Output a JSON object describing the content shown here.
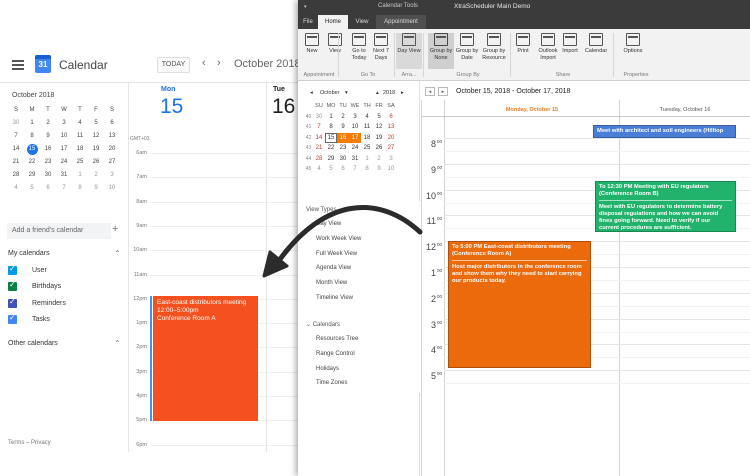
{
  "gcal": {
    "app_title": "Calendar",
    "logo_day": "31",
    "today_label": "TODAY",
    "prev_icon": "‹",
    "next_icon": "›",
    "current_month": "October 2018",
    "mini_title": "October 2018",
    "mini_weekdays": [
      "S",
      "M",
      "T",
      "W",
      "T",
      "F",
      "S"
    ],
    "mini_weeks": [
      [
        "30",
        "1",
        "2",
        "3",
        "4",
        "5",
        "6"
      ],
      [
        "7",
        "8",
        "9",
        "10",
        "11",
        "12",
        "13"
      ],
      [
        "14",
        "15",
        "16",
        "17",
        "18",
        "19",
        "20"
      ],
      [
        "21",
        "22",
        "23",
        "24",
        "25",
        "26",
        "27"
      ],
      [
        "28",
        "29",
        "30",
        "31",
        "1",
        "2",
        "3"
      ],
      [
        "4",
        "5",
        "6",
        "7",
        "8",
        "9",
        "10"
      ]
    ],
    "friend_placeholder": "Add a friend's calendar",
    "my_calendars": "My calendars",
    "calendars": [
      {
        "label": "User",
        "color": "#039be5"
      },
      {
        "label": "Birthdays",
        "color": "#0b8043"
      },
      {
        "label": "Reminders",
        "color": "#3f51b5"
      },
      {
        "label": "Tasks",
        "color": "#4285f4"
      }
    ],
    "other_calendars": "Other calendars",
    "terms": "Terms – Privacy",
    "days": [
      {
        "name": "Mon",
        "num": "15",
        "color": "#1a73e8"
      },
      {
        "name": "Tue",
        "num": "16",
        "color": "#222222"
      }
    ],
    "gmt": "GMT+03",
    "times": [
      "6am",
      "7am",
      "8am",
      "9am",
      "10am",
      "11am",
      "12pm",
      "1pm",
      "2pm",
      "3pm",
      "4pm",
      "5pm",
      "6pm"
    ],
    "event": {
      "title": "East-coast distributors meeting",
      "time": "12:00–5:00pm",
      "location": "Conference Room A",
      "color": "#f4511e"
    }
  },
  "xs": {
    "window_title": "XtraScheduler Main Demo",
    "context_tab": "Calendar Tools",
    "tabs": [
      "File",
      "Home",
      "View",
      "Appointment"
    ],
    "ribbon": {
      "buttons": [
        "New",
        "View",
        "Go to Today",
        "Next 7 Days",
        "Day View",
        "Group by None",
        "Group by Date",
        "Group by Resource",
        "Print",
        "Outlook Import",
        "Import",
        "Calendar",
        "Options"
      ],
      "groups": [
        "Appointment",
        "Go To",
        "Arra...",
        "Group By",
        "Share",
        "Properties"
      ]
    },
    "mini": {
      "month": "October",
      "year": "2018",
      "weekdays": [
        "SU",
        "MO",
        "TU",
        "WE",
        "TH",
        "FR",
        "SA"
      ],
      "weeks": [
        {
          "wk": "40",
          "days": [
            "30",
            "1",
            "2",
            "3",
            "4",
            "5",
            "6"
          ]
        },
        {
          "wk": "41",
          "days": [
            "7",
            "8",
            "9",
            "10",
            "11",
            "12",
            "13"
          ]
        },
        {
          "wk": "42",
          "days": [
            "14",
            "15",
            "16",
            "17",
            "18",
            "19",
            "20"
          ]
        },
        {
          "wk": "43",
          "days": [
            "21",
            "22",
            "23",
            "24",
            "25",
            "26",
            "27"
          ]
        },
        {
          "wk": "44",
          "days": [
            "28",
            "29",
            "30",
            "31",
            "1",
            "2",
            "3"
          ]
        },
        {
          "wk": "45",
          "days": [
            "4",
            "5",
            "6",
            "7",
            "8",
            "9",
            "10"
          ]
        }
      ]
    },
    "nav": {
      "view_types": "View Types",
      "views": [
        "Day View",
        "Work Week View",
        "Full Week View",
        "Agenda View",
        "Month View",
        "Timeline View"
      ],
      "calendars": "Calendars",
      "items": [
        "Resources Tree",
        "Range Control",
        "Holidays",
        "Time Zones"
      ]
    },
    "date_range": "October 15, 2018 - October 17, 2018",
    "day_headers": [
      {
        "label": "Monday, October 15",
        "color": "#e67e22"
      },
      {
        "label": "Tuesday, October 16",
        "color": "#555555"
      }
    ],
    "hours": [
      "8",
      "9",
      "10",
      "11",
      "12",
      "1",
      "2",
      "3",
      "4",
      "5"
    ],
    "minute_suffix": "00",
    "appointments": [
      {
        "header": "",
        "body": "Meet with architect and soil engineers (Hilltop",
        "color": "#4a7ed6"
      },
      {
        "header": "To 12:30 PM Meeting with EU regulators (Conference Room B)",
        "body": "Meet with EU regulators to determine battery disposal regulations and how we can avoid fines going forward. Need to verify if our current procedures are sufficient.",
        "color": "#21b36b"
      },
      {
        "header": "To 5:00 PM East-coast distributors meeting (Conference Room A)",
        "body": "Host major distributors in the conference room and show them why they need to start carrying our products today.",
        "color": "#ea6a0c"
      }
    ]
  }
}
